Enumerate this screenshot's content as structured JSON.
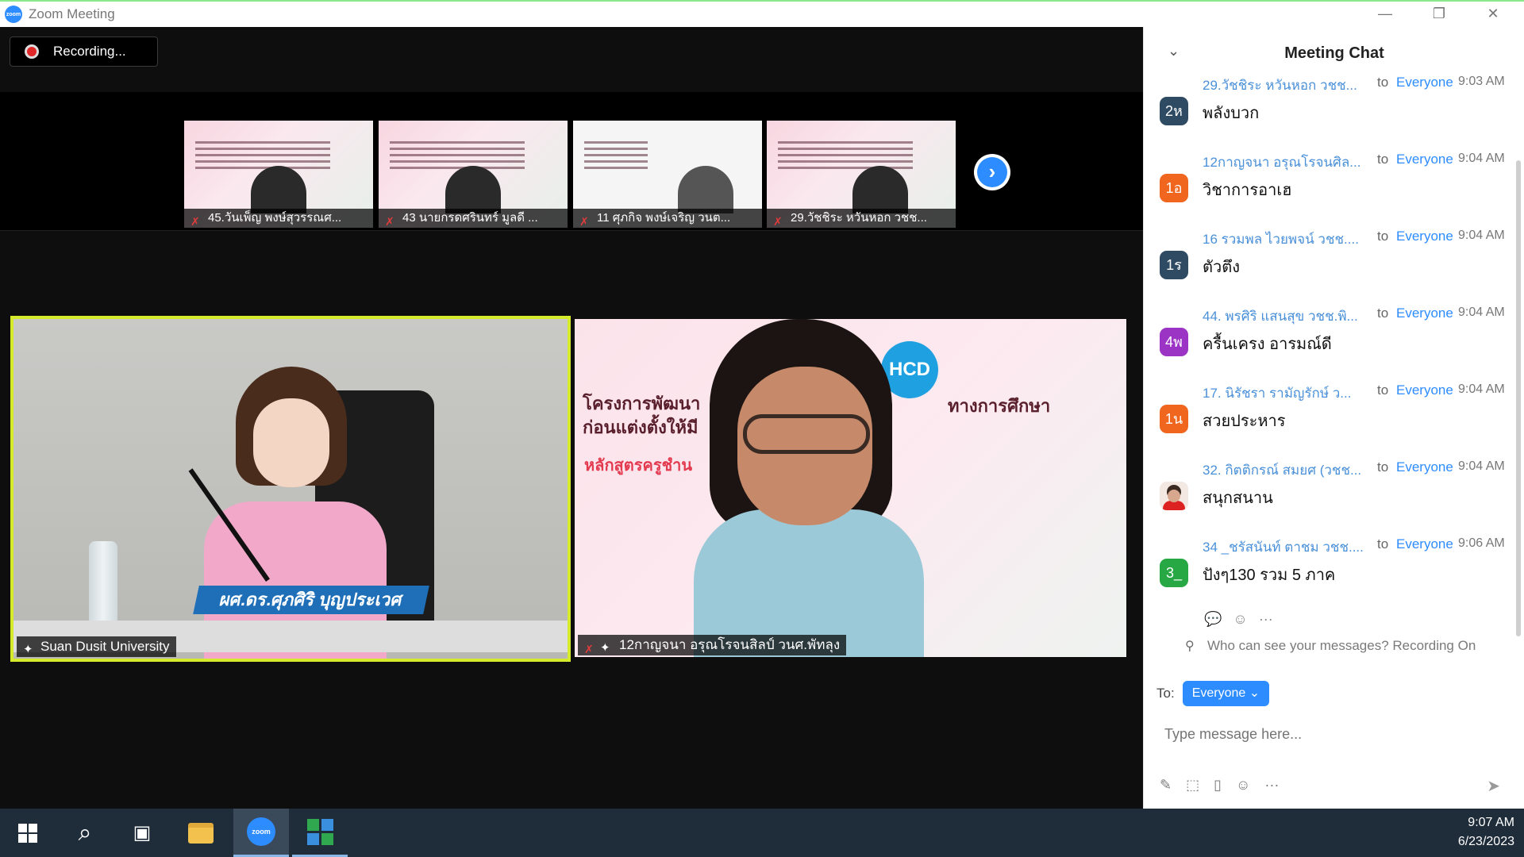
{
  "window": {
    "title": "Zoom Meeting",
    "minimize_label": "—",
    "restore_label": "❐",
    "close_label": "✕"
  },
  "recording": {
    "label": "Recording..."
  },
  "thumbnails": [
    {
      "name": "45.วันเพ็ญ พงษ์สุวรรณศ..."
    },
    {
      "name": "43 นายกรดศรินทร์ มูลดี ..."
    },
    {
      "name": "11 ศุภกิจ พงษ์เจริญ วนต..."
    },
    {
      "name": "29.วัชชิระ หวันหอก วชช..."
    }
  ],
  "next_arrow": "›",
  "main_tiles": {
    "left": {
      "label": "Suan Dusit University",
      "nameplate": "ผศ.ดร.ศุภศิริ บุญประเวศ"
    },
    "right": {
      "label": "12กาญจนา อรุณโรจนสิลป์ วนศ.พัทลุง",
      "slide_line1": "โครงการพัฒนา",
      "slide_line2": "ก่อนแต่งตั้งให้มี",
      "slide_line3": "ทางการศึกษา",
      "slide_red": "หลักสูตรครูชำน",
      "logo_text": "HCD"
    }
  },
  "chat": {
    "title": "Meeting Chat",
    "messages": [
      {
        "avatar": "2ห",
        "avatar_color": "#2f4a63",
        "sender": "29.วัชชิระ หวันหอก วชช...",
        "to": "to",
        "target": "Everyone",
        "time": "9:03 AM",
        "text": "พลังบวก"
      },
      {
        "avatar": "1อ",
        "avatar_color": "#f0661e",
        "sender": "12กาญจนา อรุณโรจนศิล...",
        "to": "to",
        "target": "Everyone",
        "time": "9:04 AM",
        "text": "วิชาการอาเฮ"
      },
      {
        "avatar": "1ร",
        "avatar_color": "#2f4a63",
        "sender": "16 รวมพล ไวยพจน์ วชช....",
        "to": "to",
        "target": "Everyone",
        "time": "9:04 AM",
        "text": "ตัวตึง"
      },
      {
        "avatar": "4พ",
        "avatar_color": "#9b34c4",
        "sender": "44. พรศิริ แสนสุข วชช.พิ...",
        "to": "to",
        "target": "Everyone",
        "time": "9:04 AM",
        "text": "ครื้นเครง อารมณ์ดี"
      },
      {
        "avatar": "1น",
        "avatar_color": "#f0661e",
        "sender": "17. นิรัชรา รามัญรักษ์ ว...",
        "to": "to",
        "target": "Everyone",
        "time": "9:04 AM",
        "text": "สวยประหาร"
      },
      {
        "avatar": "",
        "avatar_color": "#f3e8e2",
        "sender": "32. กิตติกรณ์ สมยศ (วชช...",
        "to": "to",
        "target": "Everyone",
        "time": "9:04 AM",
        "text": "สนุกสนาน"
      },
      {
        "avatar": "3_",
        "avatar_color": "#27a845",
        "sender": "34 _ชรัสนันท์ ตาชม วชช....",
        "to": "to",
        "target": "Everyone",
        "time": "9:06 AM",
        "text": "ปังๆ130 รวม 5 ภาค"
      }
    ],
    "privacy_text": "Who can see your messages? Recording On",
    "to_label": "To:",
    "to_value": "Everyone ⌄",
    "input_placeholder": "Type message here...",
    "reply_icon": "💬",
    "emoji_icon": "☺",
    "more_icon": "···"
  },
  "taskbar": {
    "time": "9:07 AM",
    "date": "6/23/2023",
    "zoom_label": "zoom"
  }
}
